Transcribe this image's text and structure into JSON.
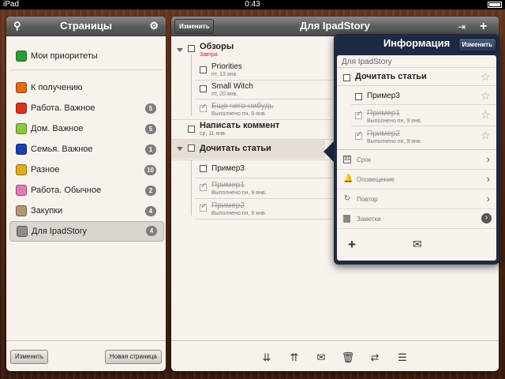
{
  "status": {
    "device": "iPad",
    "time": "0:43"
  },
  "left": {
    "title": "Страницы",
    "items": [
      {
        "label": "Мои приоритеты",
        "color": "#2e9b36",
        "count": ""
      },
      {
        "label": "К получению",
        "color": "#e06a18",
        "count": ""
      },
      {
        "label": "Работа. Важное",
        "color": "#d8321e",
        "count": "5"
      },
      {
        "label": "Дом. Важное",
        "color": "#8dc63f",
        "count": "5"
      },
      {
        "label": "Семья. Важное",
        "color": "#1b3fa6",
        "count": "1"
      },
      {
        "label": "Разное",
        "color": "#d8b021",
        "count": "10"
      },
      {
        "label": "Работа. Обычное",
        "color": "#e07bb4",
        "count": "2"
      },
      {
        "label": "Закупки",
        "color": "#b29670",
        "count": "4"
      },
      {
        "label": "Для IpadStory",
        "color": "#8c8c8c",
        "count": "4"
      }
    ],
    "edit_button": "Изменить",
    "new_page_button": "Новая страница"
  },
  "main": {
    "title": "Для IpadStory",
    "edit_button": "Изменить",
    "tasks": {
      "t1": "Обзоры",
      "t1_sub": "Завтра",
      "t1a": "Priorities",
      "t1a_sub": "пт, 13 янв.",
      "t1b": "Small Witch",
      "t1b_sub": "пт, 20 янв.",
      "t1c": "Еще чего-нибудь",
      "t1c_sub": "Выполнено пн, 9 янв.",
      "t2": "Написать коммент",
      "t2_sub": "ср, 11 янв.",
      "t3": "Дочитать статьи",
      "t3a": "Пример3",
      "t3b": "Пример1",
      "t3b_sub": "Выполнено пн, 9 янв.",
      "t3c": "Пример2",
      "t3c_sub": "Выполнено пн, 9 янв."
    }
  },
  "popover": {
    "title": "Информация",
    "edit_button": "Изменить",
    "page_name": "Для IpadStory",
    "task": "Дочитать статьи",
    "sub1": "Пример3",
    "sub2": "Пример1",
    "sub2_sub": "Выполнено пн, 9 янв.",
    "sub3": "Пример2",
    "sub3_sub": "Выполнено пн, 9 янв.",
    "rows": {
      "due": "Срок",
      "alert": "Оповещение",
      "repeat": "Повтор",
      "notes": "Заметки"
    },
    "calendar_day": "31"
  }
}
